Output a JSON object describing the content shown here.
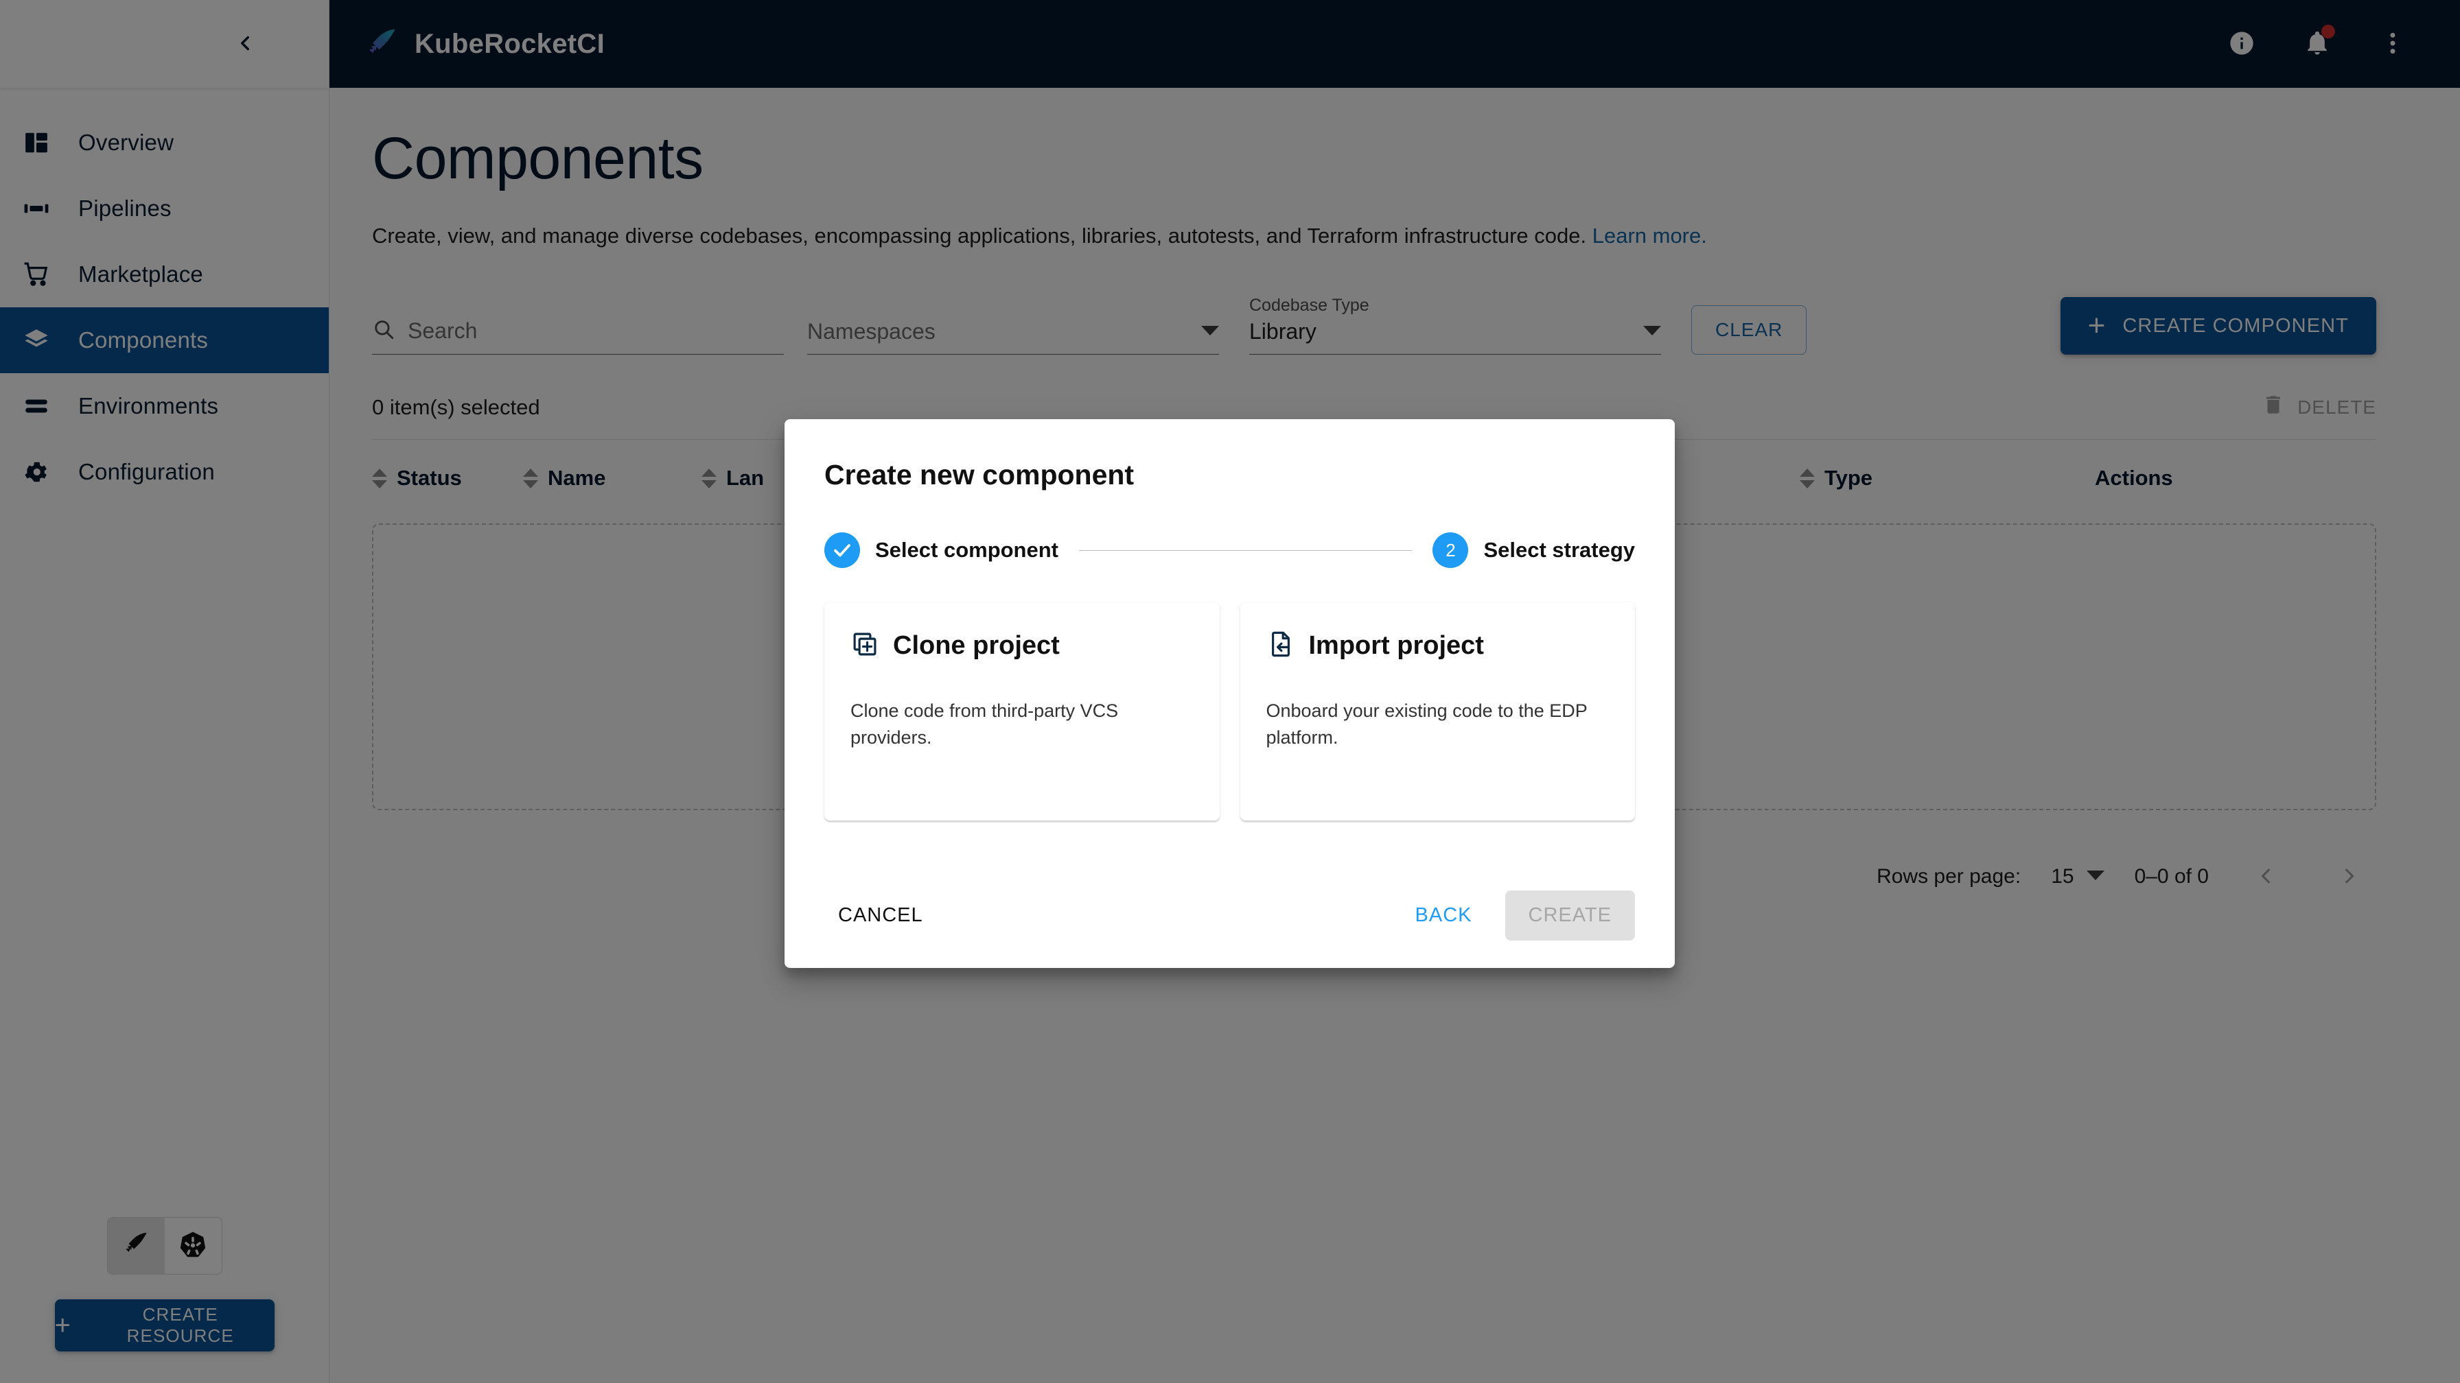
{
  "appbar": {
    "brand_name": "KubeRocketCI",
    "brand_logo_icon": "rocket-feather-icon",
    "info_icon": "info-circle-icon",
    "notifications_icon": "bell-icon",
    "notifications_has_badge": true,
    "overflow_icon": "more-vertical-icon",
    "background_color": "#04182c"
  },
  "sidebar": {
    "collapse_icon": "chevron-left-icon",
    "items": [
      {
        "label": "Overview",
        "icon": "dashboard-icon",
        "active": false
      },
      {
        "label": "Pipelines",
        "icon": "pipeline-icon",
        "active": false
      },
      {
        "label": "Marketplace",
        "icon": "cart-icon",
        "active": false
      },
      {
        "label": "Components",
        "icon": "layers-icon",
        "active": true
      },
      {
        "label": "Environments",
        "icon": "stack-lines-icon",
        "active": false
      },
      {
        "label": "Configuration",
        "icon": "gear-icon",
        "active": false
      }
    ],
    "switcher": {
      "options": [
        {
          "icon": "rocket-feather-icon",
          "selected": true
        },
        {
          "icon": "kubernetes-helm-icon",
          "selected": false
        }
      ]
    },
    "create_resource_label": "CREATE RESOURCE",
    "create_resource_icon": "plus-icon",
    "accent_color": "#0b5394"
  },
  "main": {
    "title": "Components",
    "description": "Create, view, and manage diverse codebases, encompassing applications, libraries, autotests, and Terraform infrastructure code.",
    "learn_more_label": "Learn more.",
    "filters": {
      "search": {
        "placeholder": "Search",
        "value": "",
        "icon": "search-icon"
      },
      "namespaces": {
        "label": "",
        "placeholder": "Namespaces",
        "value": "",
        "icon": "chevron-down-icon"
      },
      "codebase_type": {
        "label": "Codebase Type",
        "value": "Library",
        "icon": "chevron-down-icon"
      },
      "clear_label": "CLEAR"
    },
    "create_component_label": "CREATE COMPONENT",
    "create_component_icon": "plus-icon",
    "selection": {
      "count_label": "0 item(s) selected",
      "delete_label": "DELETE",
      "delete_icon": "trash-icon"
    },
    "table": {
      "columns": [
        {
          "label": "Status",
          "sortable": true
        },
        {
          "label": "Name",
          "sortable": true
        },
        {
          "label": "Lan",
          "sortable": true
        },
        {
          "label": "Type",
          "sortable": true
        },
        {
          "label": "Actions",
          "sortable": false
        }
      ],
      "rows": []
    },
    "pagination": {
      "rows_per_page_label": "Rows per page:",
      "rows_per_page_value": "15",
      "range_label": "0–0 of 0",
      "prev_icon": "chevron-left-icon",
      "next_icon": "chevron-right-icon"
    }
  },
  "dialog": {
    "title": "Create new component",
    "stepper": {
      "steps": [
        {
          "label": "Select component",
          "marker": "check",
          "state": "completed"
        },
        {
          "label": "Select strategy",
          "marker": "2",
          "state": "active"
        }
      ],
      "accent_color": "#1e9bf5"
    },
    "cards": [
      {
        "title": "Clone project",
        "icon": "copy-plus-icon",
        "description": "Clone code from third-party VCS providers."
      },
      {
        "title": "Import project",
        "icon": "file-import-icon",
        "description": "Onboard your existing code to the EDP platform."
      }
    ],
    "footer": {
      "cancel_label": "CANCEL",
      "back_label": "BACK",
      "create_label": "CREATE",
      "create_disabled": true
    }
  }
}
